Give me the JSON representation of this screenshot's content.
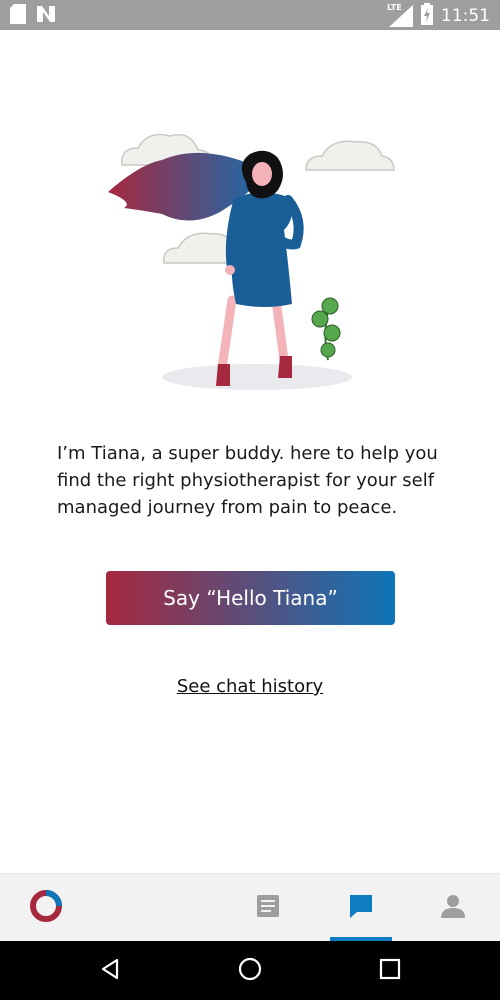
{
  "status_bar": {
    "time": "11:51",
    "network_label": "LTE",
    "icons": [
      "sd-card-icon",
      "notification-n-icon",
      "signal-icon",
      "battery-charging-icon"
    ]
  },
  "intro": {
    "text": "I’m Tiana, a super buddy. here to help you find the right physiotherapist for your self managed journey from pain to peace."
  },
  "cta": {
    "label": "Say “Hello Tiana”"
  },
  "links": {
    "chat_history": "See chat history"
  },
  "bottom_nav": {
    "items": [
      {
        "icon": "app-logo-icon",
        "active": false
      },
      {
        "icon": "document-icon",
        "active": false
      },
      {
        "icon": "chat-bubble-icon",
        "active": true
      },
      {
        "icon": "profile-icon",
        "active": false
      }
    ]
  },
  "system_nav": {
    "items": [
      "back-icon",
      "home-icon",
      "recents-icon"
    ]
  },
  "colors": {
    "gradient_start": "#a6283f",
    "gradient_end": "#0e75b8",
    "active_blue": "#0e7cc0",
    "inactive_gray": "#9e9e9e"
  }
}
